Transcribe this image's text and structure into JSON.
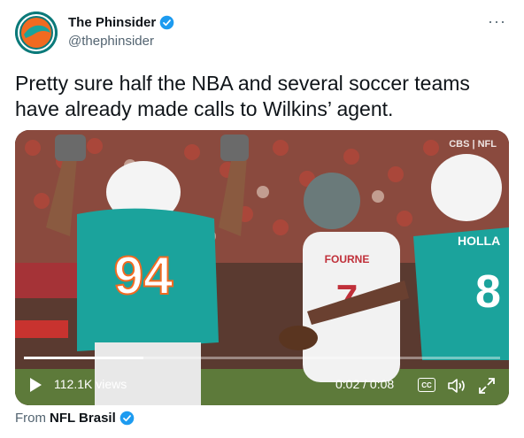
{
  "author": {
    "name": "The Phinsider",
    "handle": "@thephinsider"
  },
  "tweet": {
    "text": "Pretty sure half the NBA and several soccer teams have already made calls to Wilkins’ agent."
  },
  "video": {
    "watermark": "CBS | NFL",
    "views": "112.1K views",
    "time": "0:02 / 0:08",
    "cc_label": "CC",
    "progress": 0.25,
    "jersey_left": "94",
    "jersey_right_name": "HOLLA",
    "jersey_right_number": "8",
    "jersey_center_name": "FOURNE"
  },
  "source": {
    "prefix": "From",
    "name": "NFL Brasil"
  },
  "colors": {
    "verified": "#1d9bf0",
    "dolphins_aqua": "#1ba39c"
  }
}
